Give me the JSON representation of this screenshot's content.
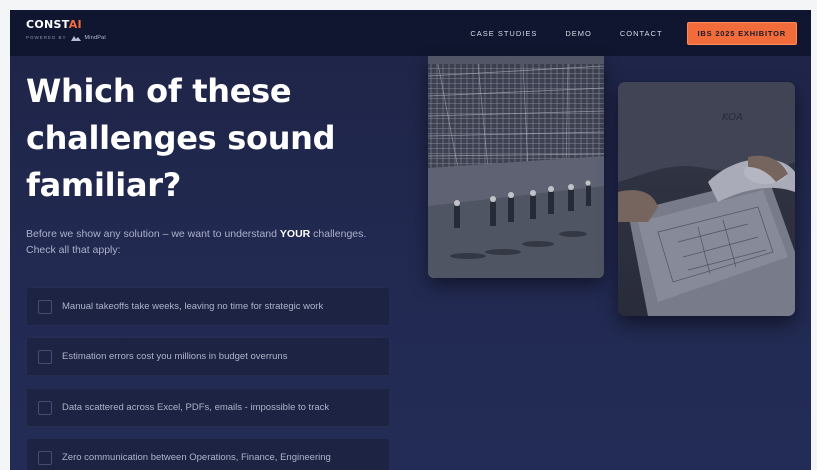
{
  "brand": {
    "name_main": "CONST",
    "name_accent": "AI",
    "powered_by": "POWERED BY",
    "partner": "MindPal",
    "accent_color": "#f26b3a"
  },
  "nav": {
    "links": [
      "CASE STUDIES",
      "DEMO",
      "CONTACT"
    ],
    "cta_label": "IBS 2025 EXHIBITOR"
  },
  "hero": {
    "headline_lines": [
      "Which of these",
      "challenges sound",
      "familiar?"
    ],
    "intro_before": "Before we show any solution – we want to understand ",
    "intro_emphasis": "YOUR",
    "intro_after": " challenges.",
    "intro_line2": "Check all that apply:"
  },
  "challenges": [
    "Manual takeoffs take weeks, leaving no time for strategic work",
    "Estimation errors cost you millions in budget overruns",
    "Data scattered across Excel, PDFs, emails - impossible to track",
    "Zero communication between Operations, Finance, Engineering"
  ],
  "images": {
    "site_photo": "construction-site-workers-photo",
    "blueprint_photo": "blueprint-review-photo",
    "shirt_logo": "KOA"
  },
  "colors": {
    "background": "#222a52",
    "nav_background": "#111630",
    "card_background": "#1d2343"
  }
}
